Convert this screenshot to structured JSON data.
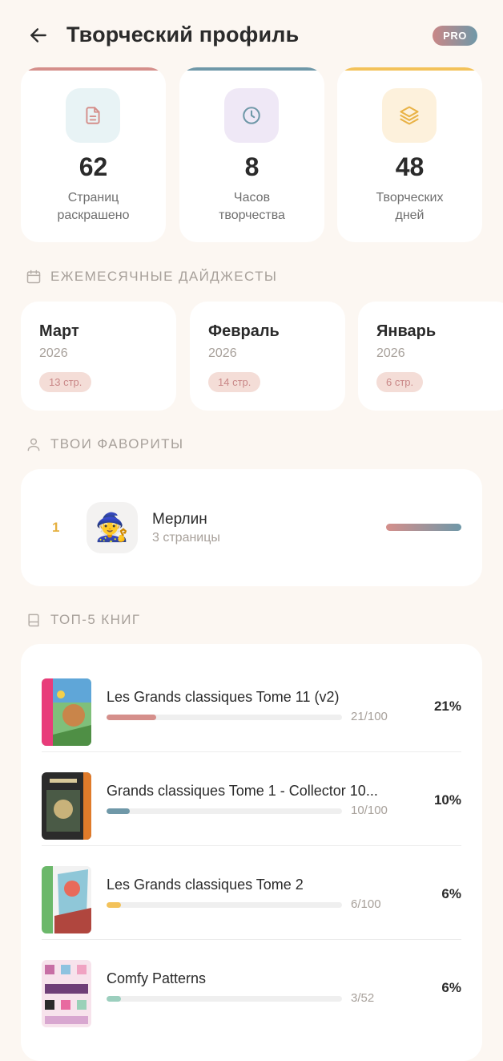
{
  "header": {
    "title": "Творческий профиль",
    "badge": "PRO"
  },
  "stats": [
    {
      "value": "62",
      "label_line1": "Страниц",
      "label_line2": "раскрашено",
      "icon": "document-icon",
      "accent": "#d58f8b",
      "tint": "#e8f3f5"
    },
    {
      "value": "8",
      "label_line1": "Часов",
      "label_line2": "творчества",
      "icon": "clock-icon",
      "accent": "#6f98a8",
      "tint": "#efe8f6"
    },
    {
      "value": "48",
      "label_line1": "Творческих",
      "label_line2": "дней",
      "icon": "layers-icon",
      "accent": "#f3c25a",
      "tint": "#fdf1dc"
    }
  ],
  "sections": {
    "digests": "ЕЖЕМЕСЯЧНЫЕ ДАЙДЖЕСТЫ",
    "favorites": "ТВОИ ФАВОРИТЫ",
    "top_books": "ТОП-5 КНИГ"
  },
  "digests": [
    {
      "month": "Март",
      "year": "2026",
      "pages": "13 стр."
    },
    {
      "month": "Февраль",
      "year": "2026",
      "pages": "14 стр."
    },
    {
      "month": "Январь",
      "year": "2026",
      "pages": "6 стр."
    }
  ],
  "favorites": [
    {
      "rank": "1",
      "name": "Мерлин",
      "pages": "3 страницы",
      "avatar": "wizard-emoji",
      "avatar_glyph": "🧙"
    }
  ],
  "books": [
    {
      "title": "Les Grands classiques Tome 11 (v2)",
      "count": "21/100",
      "percent": "21%",
      "progress": 0.21,
      "color": "#d58f8b"
    },
    {
      "title": "Grands classiques Tome 1 - Collector 10...",
      "count": "10/100",
      "percent": "10%",
      "progress": 0.1,
      "color": "#6f98a8"
    },
    {
      "title": "Les Grands classiques Tome 2",
      "count": "6/100",
      "percent": "6%",
      "progress": 0.06,
      "color": "#f3c25a"
    },
    {
      "title": "Comfy Patterns",
      "count": "3/52",
      "percent": "6%",
      "progress": 0.06,
      "color": "#9ccfbe"
    }
  ]
}
